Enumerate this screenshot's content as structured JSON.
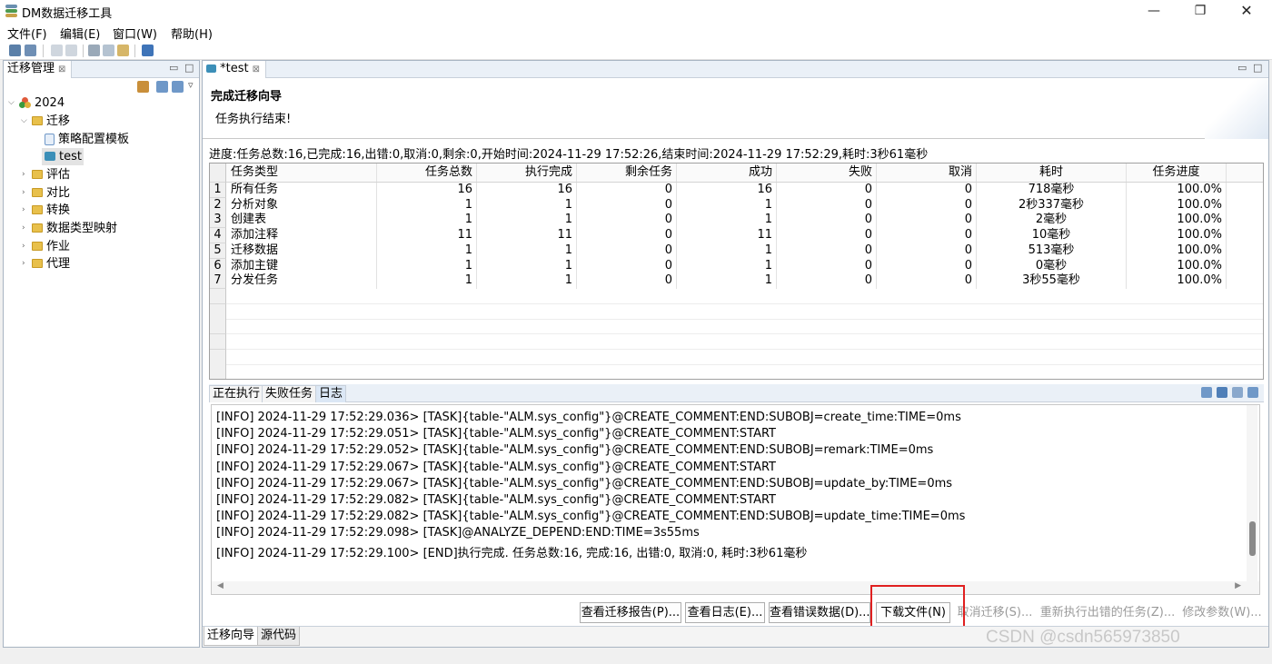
{
  "window": {
    "title": "DM数据迁移工具",
    "min": "—",
    "max": "❐",
    "close": "✕"
  },
  "menu": [
    "文件(F)",
    "编辑(E)",
    "窗口(W)",
    "帮助(H)"
  ],
  "left_panel": {
    "tab_title": "迁移管理",
    "close": "⊠",
    "tree": {
      "root": "2024",
      "migration": "迁移",
      "template": "策略配置模板",
      "test": "test",
      "folders": [
        "评估",
        "对比",
        "转换",
        "数据类型映射",
        "作业",
        "代理"
      ]
    }
  },
  "editor": {
    "tab_title": "*test",
    "close": "⊠",
    "wizard_title": "完成迁移向导",
    "wizard_message": "任务执行结束!",
    "progress": "进度:任务总数:16,已完成:16,出错:0,取消:0,剩余:0,开始时间:2024-11-29 17:52:26,结束时间:2024-11-29 17:52:29,耗时:3秒61毫秒",
    "table": {
      "headers": [
        "任务类型",
        "任务总数",
        "执行完成",
        "剩余任务",
        "成功",
        "失败",
        "取消",
        "耗时",
        "任务进度"
      ],
      "rows": [
        [
          "1",
          "所有任务",
          "16",
          "16",
          "0",
          "16",
          "0",
          "0",
          "718毫秒",
          "100.0%"
        ],
        [
          "2",
          "分析对象",
          "1",
          "1",
          "0",
          "1",
          "0",
          "0",
          "2秒337毫秒",
          "100.0%"
        ],
        [
          "3",
          "创建表",
          "1",
          "1",
          "0",
          "1",
          "0",
          "0",
          "2毫秒",
          "100.0%"
        ],
        [
          "4",
          "添加注释",
          "11",
          "11",
          "0",
          "11",
          "0",
          "0",
          "10毫秒",
          "100.0%"
        ],
        [
          "5",
          "迁移数据",
          "1",
          "1",
          "0",
          "1",
          "0",
          "0",
          "513毫秒",
          "100.0%"
        ],
        [
          "6",
          "添加主键",
          "1",
          "1",
          "0",
          "1",
          "0",
          "0",
          "0毫秒",
          "100.0%"
        ],
        [
          "7",
          "分发任务",
          "1",
          "1",
          "0",
          "1",
          "0",
          "0",
          "3秒55毫秒",
          "100.0%"
        ]
      ]
    },
    "log_tabs": [
      "正在执行",
      "失败任务",
      "日志"
    ],
    "log_lines": [
      "[INFO] 2024-11-29 17:52:29.036> [TASK]{table-\"ALM.sys_config\"}@CREATE_COMMENT:END:SUBOBJ=create_time:TIME=0ms",
      "[INFO] 2024-11-29 17:52:29.051> [TASK]{table-\"ALM.sys_config\"}@CREATE_COMMENT:START",
      "[INFO] 2024-11-29 17:52:29.052> [TASK]{table-\"ALM.sys_config\"}@CREATE_COMMENT:END:SUBOBJ=remark:TIME=0ms",
      "[INFO] 2024-11-29 17:52:29.067> [TASK]{table-\"ALM.sys_config\"}@CREATE_COMMENT:START",
      "[INFO] 2024-11-29 17:52:29.067> [TASK]{table-\"ALM.sys_config\"}@CREATE_COMMENT:END:SUBOBJ=update_by:TIME=0ms",
      "[INFO] 2024-11-29 17:52:29.082> [TASK]{table-\"ALM.sys_config\"}@CREATE_COMMENT:START",
      "[INFO] 2024-11-29 17:52:29.082> [TASK]{table-\"ALM.sys_config\"}@CREATE_COMMENT:END:SUBOBJ=update_time:TIME=0ms",
      "[INFO] 2024-11-29 17:52:29.098> [TASK]@ANALYZE_DEPEND:END:TIME=3s55ms",
      "[INFO] 2024-11-29 17:52:29.100> [END]执行完成. 任务总数:16, 完成:16, 出错:0, 取消:0, 耗时:3秒61毫秒"
    ],
    "buttons": {
      "view_report": "查看迁移报告(P)...",
      "view_log": "查看日志(E)...",
      "view_error": "查看错误数据(D)...",
      "download": "下载文件(N)",
      "cancel": "取消迁移(S)...",
      "rerun": "重新执行出错的任务(Z)...",
      "modify": "修改参数(W)..."
    },
    "bottom_tabs": [
      "迁移向导",
      "源代码"
    ]
  },
  "watermark": "CSDN @csdn565973850",
  "colors": {
    "highlight_border": "#e02020",
    "folder": "#e8c04b"
  }
}
